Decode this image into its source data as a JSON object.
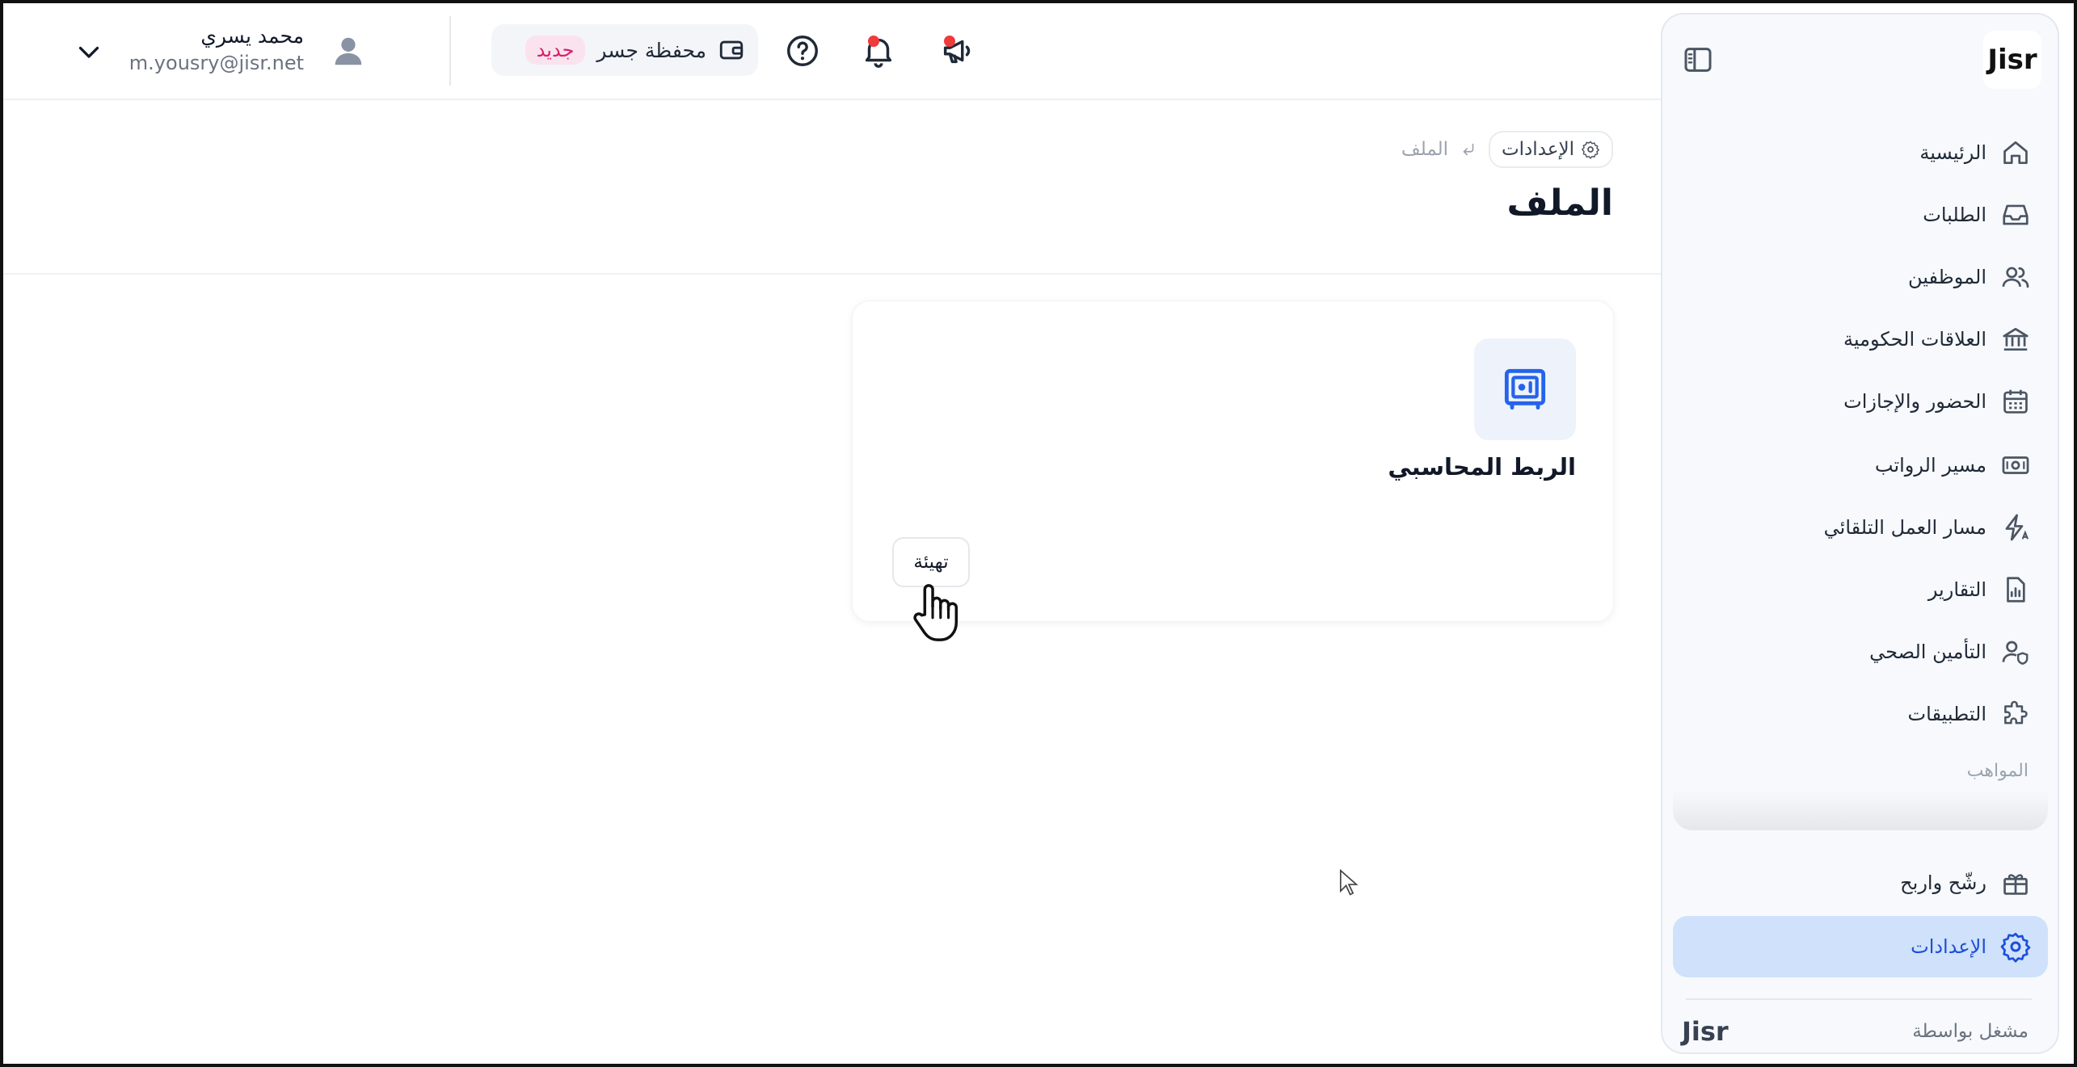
{
  "header": {
    "user": {
      "name": "محمد يسري",
      "email": "m.yousry@jisr.net"
    },
    "wallet": {
      "label": "محفظة جسر",
      "badge": "جديد"
    }
  },
  "sidebar": {
    "logo": "Jisr",
    "items": [
      {
        "label": "الرئيسية",
        "icon": "home-icon"
      },
      {
        "label": "الطلبات",
        "icon": "inbox-icon"
      },
      {
        "label": "الموظفين",
        "icon": "users-icon"
      },
      {
        "label": "العلاقات الحكومية",
        "icon": "bank-icon"
      },
      {
        "label": "الحضور والإجازات",
        "icon": "calendar-icon"
      },
      {
        "label": "مسير الرواتب",
        "icon": "banknote-icon"
      },
      {
        "label": "مسار العمل التلقائي",
        "icon": "automation-icon"
      },
      {
        "label": "التقارير",
        "icon": "report-icon"
      },
      {
        "label": "التأمين الصحي",
        "icon": "user-shield-icon"
      },
      {
        "label": "التطبيقات",
        "icon": "puzzle-icon"
      }
    ],
    "section_label": "المواهب",
    "referral": {
      "label": "رشّح واربح",
      "icon": "gift-icon"
    },
    "settings": {
      "label": "الإعدادات",
      "icon": "gear-icon",
      "active": true
    },
    "powered_by": "مشغل بواسطة",
    "powered_logo": "Jisr"
  },
  "breadcrumb": {
    "parent": "الإعدادات",
    "current": "الملف"
  },
  "page": {
    "title": "الملف"
  },
  "card": {
    "title": "الربط المحاسبي",
    "button": "تهيئة"
  },
  "colors": {
    "accent": "#1d4ed8",
    "active_bg": "#cfe1fb",
    "badge_text": "#d61f69",
    "badge_bg": "#fbe3ee",
    "notify": "#ef3b3b"
  }
}
